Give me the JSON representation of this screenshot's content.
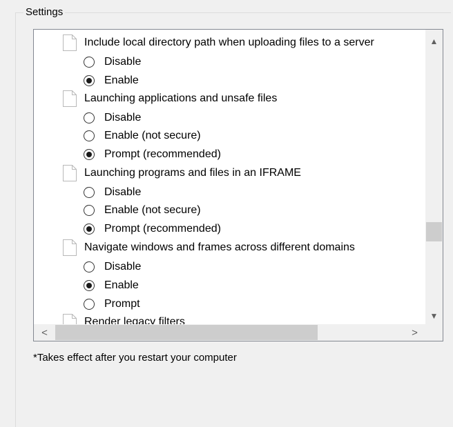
{
  "group": {
    "label": "Settings"
  },
  "tree": {
    "items": [
      {
        "label": "Include local directory path when uploading files to a server",
        "options": [
          {
            "label": "Disable",
            "checked": false
          },
          {
            "label": "Enable",
            "checked": true
          }
        ]
      },
      {
        "label": "Launching applications and unsafe files",
        "options": [
          {
            "label": "Disable",
            "checked": false
          },
          {
            "label": "Enable (not secure)",
            "checked": false
          },
          {
            "label": "Prompt (recommended)",
            "checked": true
          }
        ]
      },
      {
        "label": "Launching programs and files in an IFRAME",
        "options": [
          {
            "label": "Disable",
            "checked": false
          },
          {
            "label": "Enable (not secure)",
            "checked": false
          },
          {
            "label": "Prompt (recommended)",
            "checked": true
          }
        ]
      },
      {
        "label": "Navigate windows and frames across different domains",
        "options": [
          {
            "label": "Disable",
            "checked": false
          },
          {
            "label": "Enable",
            "checked": true
          },
          {
            "label": "Prompt",
            "checked": false
          }
        ]
      },
      {
        "label": "Render legacy filters",
        "options": []
      }
    ]
  },
  "scrollbars": {
    "up_arrow": "▲",
    "down_arrow": "▼",
    "left_arrow": "<",
    "right_arrow": ">"
  },
  "footer": {
    "note": "*Takes effect after you restart your computer"
  }
}
